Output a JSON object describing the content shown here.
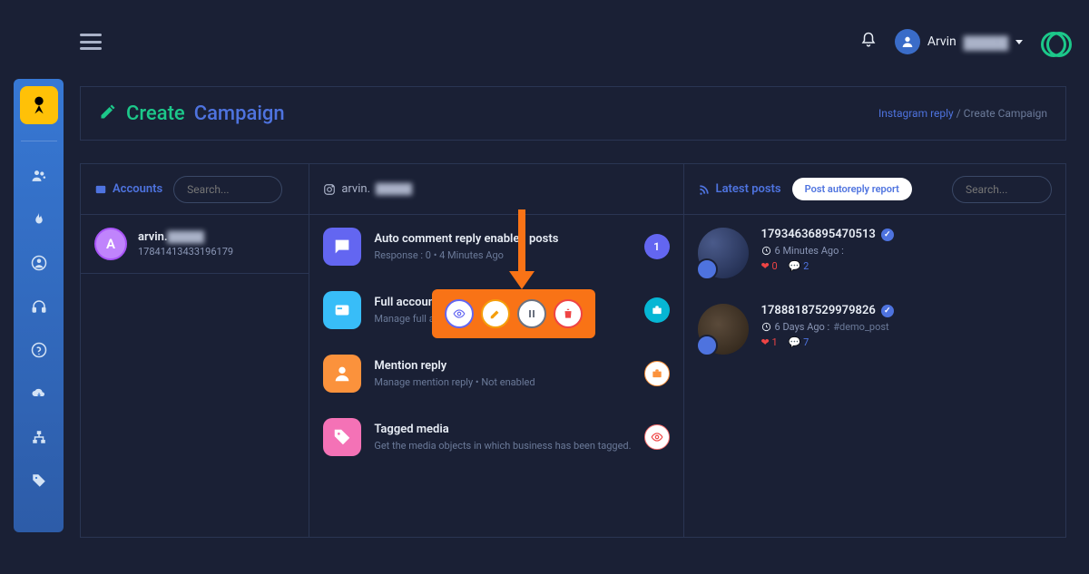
{
  "topbar": {
    "user_name": "Arvin"
  },
  "header": {
    "title_1": "Create",
    "title_2": "Campaign",
    "breadcrumb_link": "Instagram reply",
    "breadcrumb_current": "Create Campaign"
  },
  "col1": {
    "title": "Accounts",
    "search_placeholder": "Search...",
    "account": {
      "initial": "A",
      "name": "arvin.",
      "id": "17841413433196179"
    }
  },
  "col2": {
    "handle": "arvin.",
    "features": [
      {
        "title": "Auto comment reply enabled posts",
        "sub": "Response : 0  •  4 Minutes Ago",
        "badge": "1"
      },
      {
        "title": "Full account reply",
        "sub": "Manage full accoun"
      },
      {
        "title": "Mention reply",
        "sub": "Manage mention reply  •  Not enabled"
      },
      {
        "title": "Tagged media",
        "sub": "Get the media objects in which business has been tagged."
      }
    ]
  },
  "col3": {
    "title": "Latest posts",
    "button": "Post autoreply report",
    "search_placeholder": "Search...",
    "posts": [
      {
        "id": "17934636895470513",
        "time": "6 Minutes Ago :",
        "hearts": "0",
        "comments": "2"
      },
      {
        "id": "17888187529979826",
        "time": "6 Days Ago :",
        "tag": "#demo_post",
        "hearts": "1",
        "comments": "7"
      }
    ]
  }
}
